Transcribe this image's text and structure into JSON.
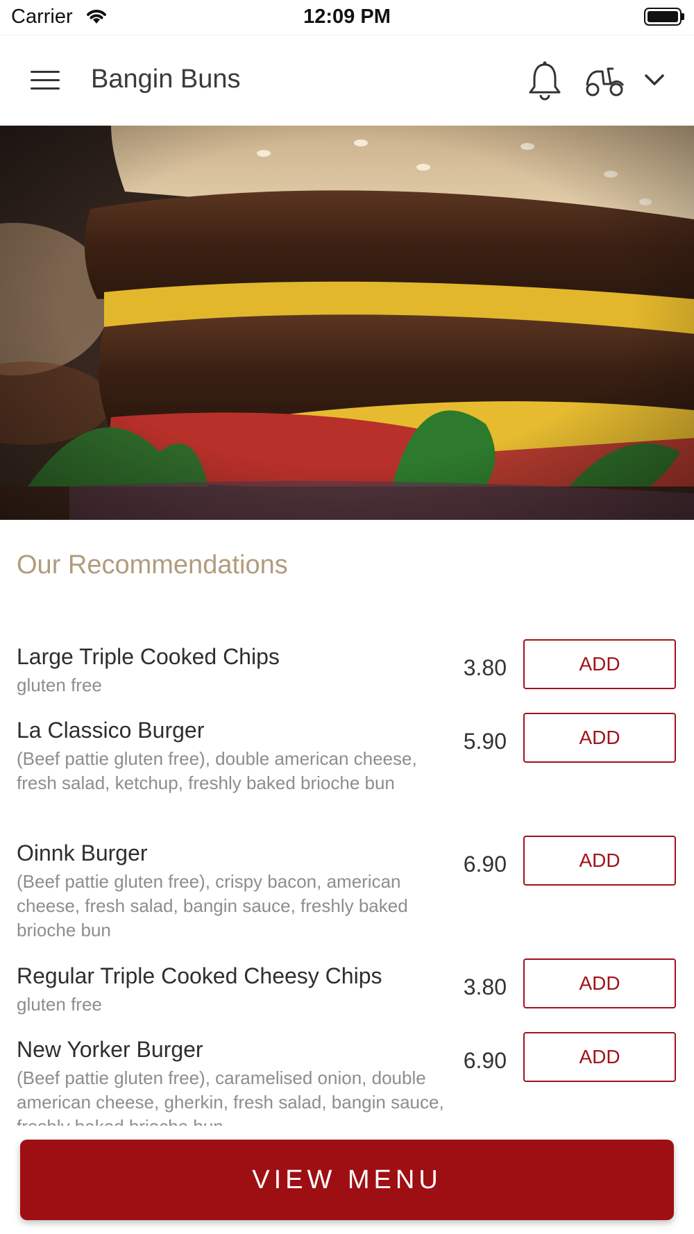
{
  "status_bar": {
    "carrier": "Carrier",
    "time": "12:09 PM"
  },
  "header": {
    "title": "Bangin Buns"
  },
  "section": {
    "title": "Our Recommendations"
  },
  "items": [
    {
      "name": "Large Triple Cooked Chips",
      "desc": "gluten free",
      "price": "3.80",
      "add": "ADD"
    },
    {
      "name": "La Classico Burger",
      "desc": "(Beef pattie gluten free), double american cheese, fresh salad, ketchup, freshly baked brioche bun",
      "price": "5.90",
      "add": "ADD"
    },
    {
      "name": "Oinnk Burger",
      "desc": "(Beef pattie gluten free), crispy bacon, american cheese, fresh salad, bangin sauce, freshly baked brioche bun",
      "price": "6.90",
      "add": "ADD"
    },
    {
      "name": "Regular Triple Cooked Cheesy Chips",
      "desc": "gluten free",
      "price": "3.80",
      "add": "ADD"
    },
    {
      "name": "New Yorker Burger",
      "desc": "(Beef pattie gluten free), caramelised onion, double american cheese, gherkin, fresh salad, bangin sauce, freshly baked brioche bun",
      "price": "6.90",
      "add": "ADD"
    }
  ],
  "footer": {
    "view_menu": "VIEW MENU"
  },
  "colors": {
    "accent": "#9e0f14",
    "section_title": "#b19c7d"
  }
}
